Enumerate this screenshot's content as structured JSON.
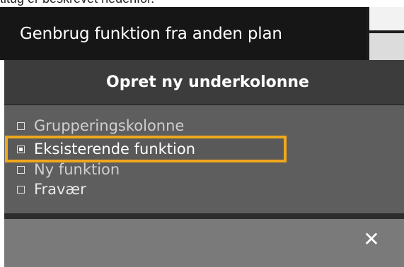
{
  "caption": "titug er beskrevet nedenfor.",
  "tab": {
    "active_label": "Genbrug funktion fra anden plan"
  },
  "dialog": {
    "title": "Opret ny underkolonne",
    "options": [
      {
        "label": "Grupperingskolonne",
        "selected": false
      },
      {
        "label": "Eksisterende funktion",
        "selected": true
      },
      {
        "label": "Ny funktion",
        "selected": false
      },
      {
        "label": "Fravær",
        "selected": false
      }
    ],
    "highlight_color": "#f0a81c",
    "close_icon": "close-icon"
  }
}
